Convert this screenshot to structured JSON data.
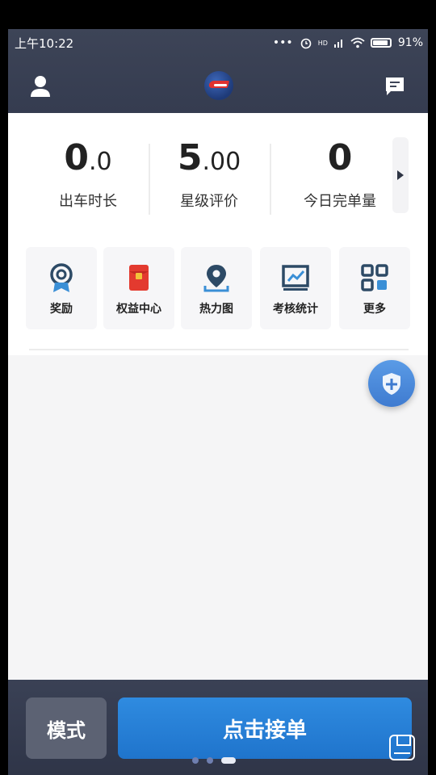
{
  "status_bar": {
    "time": "上午10:22",
    "dots": "•••",
    "hd_label": "HD",
    "battery": "91%"
  },
  "header": {
    "user_icon": "user-icon",
    "logo": "app-logo",
    "message_icon": "message-icon"
  },
  "stats": {
    "items": [
      {
        "value_main": "0",
        "value_dec": ".0",
        "label": "出车时长"
      },
      {
        "value_main": "5",
        "value_dec": ".00",
        "label": "星级评价"
      },
      {
        "value_main": "0",
        "value_dec": "",
        "label": "今日完单量"
      }
    ],
    "more_icon": "chevron-right-icon"
  },
  "tools": {
    "items": [
      {
        "label": "奖励",
        "icon": "award-icon"
      },
      {
        "label": "权益中心",
        "icon": "red-envelope-icon"
      },
      {
        "label": "热力图",
        "icon": "location-pin-icon"
      },
      {
        "label": "考核统计",
        "icon": "chart-icon"
      },
      {
        "label": "更多",
        "icon": "grid-icon"
      }
    ]
  },
  "floating": {
    "shield_icon": "shield-plus-icon"
  },
  "bottom": {
    "mode_label": "模式",
    "order_label": "点击接单",
    "page_dots": 3,
    "active_dot": 2
  },
  "colors": {
    "header_bg": "#3d4457",
    "primary_blue": "#2f8be0",
    "accent_red": "#e0312f"
  }
}
